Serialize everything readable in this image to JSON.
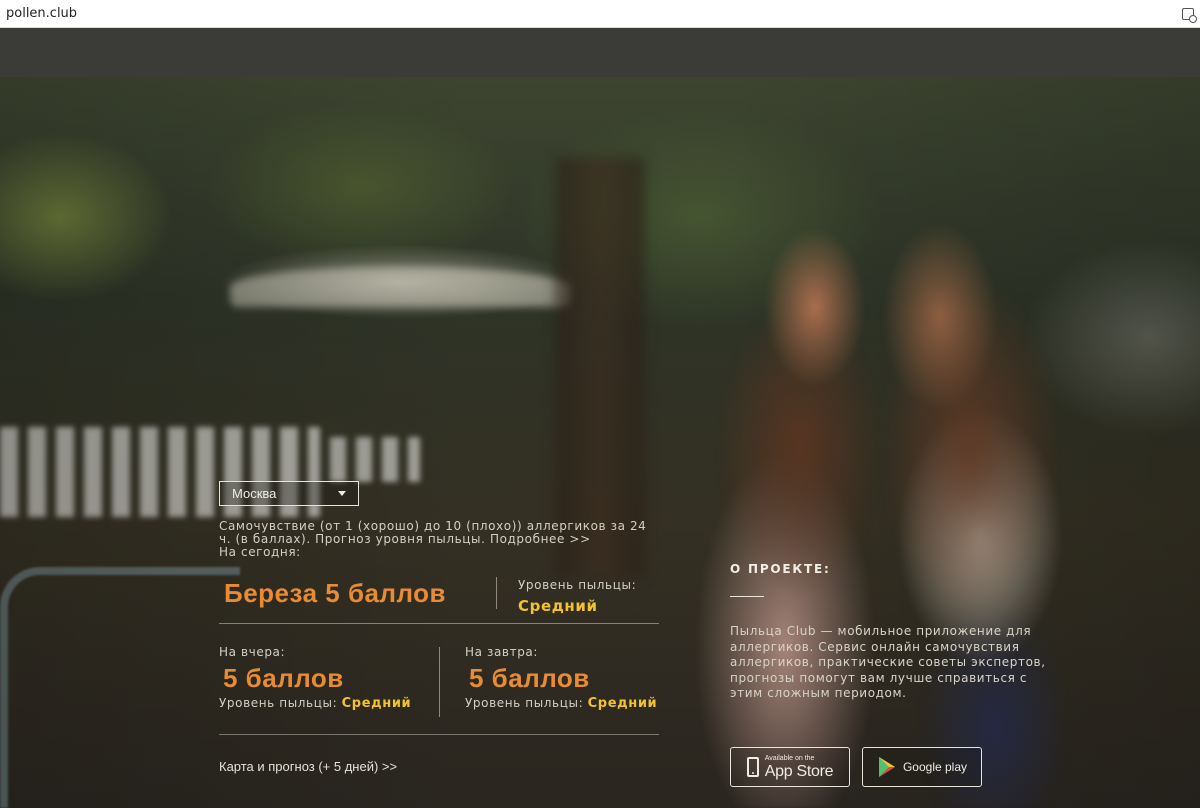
{
  "browser": {
    "tab_title": "pollen.club"
  },
  "city_select": {
    "selected": "Москва"
  },
  "intro": {
    "text": "Самочувствие (от 1 (хорошо) до 10 (плохо)) аллергиков за 24 ч. (в баллах). Прогноз уровня пыльцы. Подробнее >>",
    "today_label": "На сегодня:"
  },
  "today": {
    "headline": "Береза 5 баллов",
    "level_label": "Уровень пыльцы:",
    "level_value": "Средний"
  },
  "yesterday": {
    "label": "На вчера:",
    "score": "5 баллов",
    "level_label": "Уровень пыльцы:",
    "level_value": "Средний"
  },
  "tomorrow": {
    "label": "На завтра:",
    "score": "5 баллов",
    "level_label": "Уровень пыльцы:",
    "level_value": "Средний"
  },
  "map_link": "Карта и прогноз (+ 5 дней) >>",
  "about": {
    "title": "О ПРОЕКТЕ:",
    "text": "Пыльца Club — мобильное приложение для аллергиков. Сервис онлайн самочувствия аллергиков, практические советы экспертов, прогнозы помогут вам лучше справиться с этим сложным периодом."
  },
  "stores": {
    "appstore_small": "Available on the",
    "appstore_big": "App Store",
    "googleplay": "Google play"
  },
  "colors": {
    "accent_orange": "#e88b35",
    "level_yellow": "#f2c230",
    "nav_bg": "#3b3c38"
  },
  "icons": [
    "phone-icon",
    "play-icon",
    "chevron-down-icon"
  ]
}
